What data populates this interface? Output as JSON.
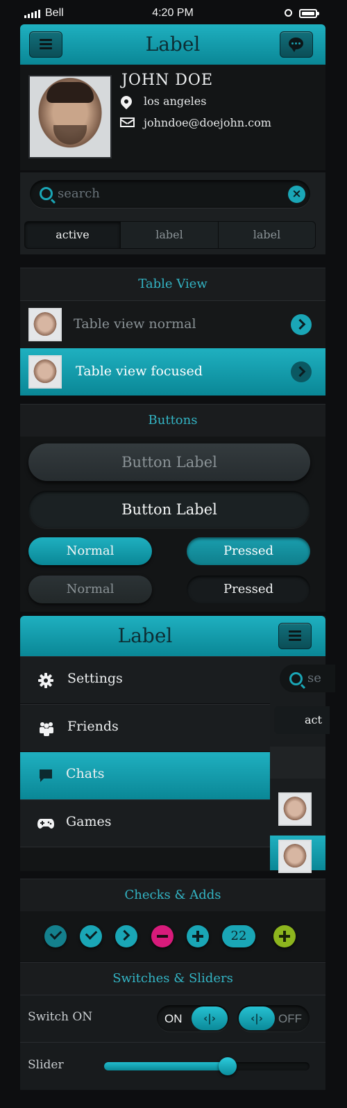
{
  "status_bar": {
    "carrier": "Bell",
    "time": "4:20 PM"
  },
  "header": {
    "title": "Label"
  },
  "profile": {
    "name": "JOHN DOE",
    "location": "los angeles",
    "email": "johndoe@doejohn.com"
  },
  "search": {
    "placeholder": "search",
    "clear": "×"
  },
  "segments": [
    "active",
    "label",
    "label"
  ],
  "table_view": {
    "heading": "Table View",
    "rows": [
      {
        "label": "Table view normal",
        "state": "normal"
      },
      {
        "label": "Table view focused",
        "state": "focused"
      }
    ]
  },
  "buttons": {
    "heading": "Buttons",
    "big": [
      "Button Label",
      "Button Label"
    ],
    "pills": [
      "Normal",
      "Pressed",
      "Normal",
      "Pressed"
    ]
  },
  "drawer": {
    "title": "Label",
    "items": [
      {
        "label": "Settings",
        "icon": "gear-icon"
      },
      {
        "label": "Friends",
        "icon": "friends-icon"
      },
      {
        "label": "Chats",
        "icon": "chat-icon",
        "selected": true
      },
      {
        "label": "Games",
        "icon": "gamepad-icon"
      }
    ],
    "peek": {
      "search": "se",
      "segment": "act"
    }
  },
  "checks": {
    "heading": "Checks & Adds",
    "badge": "22"
  },
  "switches": {
    "heading": "Switches & Sliders",
    "switch_label": "Switch ON",
    "on_text": "ON",
    "off_text": "OFF",
    "knob_glyph": "‹|›",
    "slider_label": "Slider",
    "slider_value": 0.6
  },
  "colors": {
    "accent": "#17a2b2",
    "background": "#0d0e10",
    "remove": "#d81b7b",
    "add": "#8db51e"
  }
}
